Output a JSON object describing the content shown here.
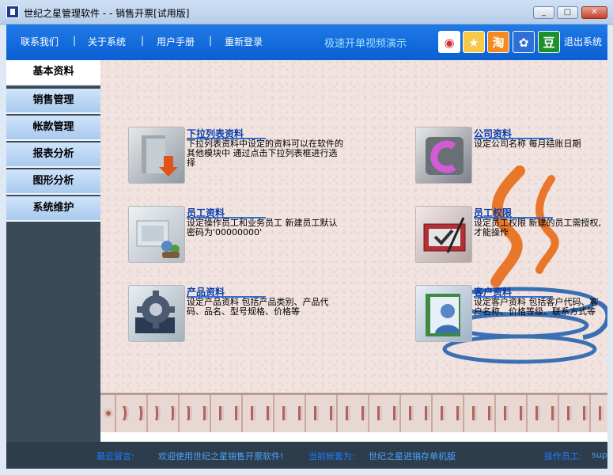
{
  "window": {
    "title": "世纪之星管理软件 - - 销售开票[试用版]",
    "controls": {
      "minimize": "_",
      "maximize": "□",
      "close": "✕"
    }
  },
  "nav": {
    "links": [
      "联系我们",
      "关于系统",
      "用户手册",
      "重新登录"
    ],
    "separator": "|",
    "promo": "极速开单视频演示",
    "social": [
      "weibo-icon",
      "star-icon",
      "taobao-icon",
      "baidu-icon",
      "douban-icon"
    ],
    "social_glyphs": [
      "◉",
      "★",
      "淘",
      "✿",
      "豆"
    ],
    "exit": "退出系统"
  },
  "sidebar": {
    "items": [
      "基本资料",
      "销售管理",
      "帐款管理",
      "报表分析",
      "图形分析",
      "系统维护"
    ],
    "active_index": 0
  },
  "tiles": [
    {
      "title": "下拉列表资料",
      "desc": "下拉列表资料中设定的资料可以在软件的其他模块中 通过点击下拉列表框进行选择",
      "icon": "dropdown-folder-icon"
    },
    {
      "title": "公司资料",
      "desc": "设定公司名称  每月结账日期",
      "icon": "company-icon"
    },
    {
      "title": "员工资料",
      "desc": "设定操作员工和业务员工  新建员工默认密码为'00000000'",
      "icon": "employee-icon"
    },
    {
      "title": "员工权限",
      "desc": "设定员工权限  新建的员工需授权,才能操作",
      "icon": "permission-icon"
    },
    {
      "title": "产品资料",
      "desc": "设定产品资料  包括产品类别、产品代码、品名、型号规格、价格等",
      "icon": "product-gear-icon"
    },
    {
      "title": "客户资料",
      "desc": "设定客户资料  包括客户代码、客户名称、价格等级、联系方式等",
      "icon": "customer-icon"
    }
  ],
  "status": {
    "msg_label": "最近留言:",
    "msg_value": "欢迎使用世纪之星销售开票软件!",
    "account_label": "当前帐套为:",
    "account_value": "世纪之星进销存单机版",
    "operator_label": "操作员工:",
    "operator_value": "sup"
  },
  "colors": {
    "nav_blue": "#0b5fd3",
    "title_link": "#0a3ea8",
    "status_bg": "#2e3d4b"
  }
}
